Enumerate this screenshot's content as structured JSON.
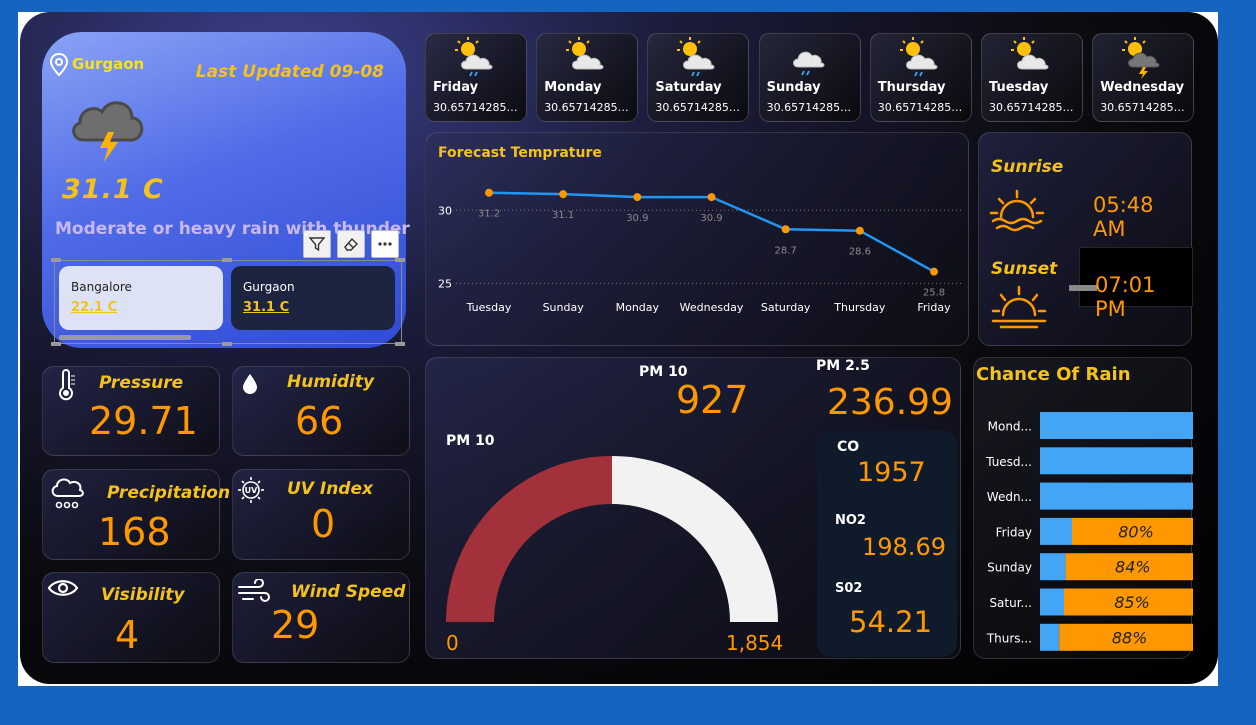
{
  "current": {
    "city": "Gurgaon",
    "last_updated": "Last Updated 09-08",
    "temperature": "31.1 C",
    "condition": "Moderate or heavy rain with thunder",
    "icon": "thunderstorm-cloud-icon"
  },
  "city_slicer": [
    {
      "name": "Bangalore",
      "temp": "22.1 C",
      "selected": false
    },
    {
      "name": "Gurgaon",
      "temp": "31.1 C",
      "selected": true
    }
  ],
  "forecast_tiles": [
    {
      "day": "Friday",
      "value": "30.657142857142857",
      "icon": "sun-cloud-rain-icon"
    },
    {
      "day": "Monday",
      "value": "30.657142857142857",
      "icon": "sun-cloud-icon"
    },
    {
      "day": "Saturday",
      "value": "30.657142857142857",
      "icon": "sun-cloud-rain-icon"
    },
    {
      "day": "Sunday",
      "value": "30.657142857142857",
      "icon": "cloud-rain-icon"
    },
    {
      "day": "Thursday",
      "value": "30.657142857142857",
      "icon": "sun-cloud-rain-icon"
    },
    {
      "day": "Tuesday",
      "value": "30.657142857142857",
      "icon": "sun-cloud-icon"
    },
    {
      "day": "Wednesday",
      "value": "30.657142857142857",
      "icon": "sun-thunder-icon"
    }
  ],
  "forecast_chart": {
    "title": "Forecast Temprature"
  },
  "chart_data": [
    {
      "type": "line",
      "title": "Forecast Temprature",
      "categories": [
        "Tuesday",
        "Sunday",
        "Monday",
        "Wednesday",
        "Saturday",
        "Thursday",
        "Friday"
      ],
      "values": [
        31.2,
        31.1,
        30.9,
        30.9,
        28.7,
        28.6,
        25.8
      ],
      "yticks": [
        25,
        30
      ],
      "ylim": [
        24,
        32
      ],
      "grid": true,
      "color": "#2196f3",
      "marker_color": "#ff9800"
    },
    {
      "type": "bar",
      "title": "Chance Of Rain",
      "categories": [
        "Mond...",
        "Tuesd...",
        "Wedn...",
        "Friday",
        "Sunday",
        "Satur...",
        "Thurs..."
      ],
      "series": [
        {
          "values": [
            100,
            100,
            100,
            20,
            16,
            15,
            12
          ],
          "color": "#42a5f5"
        },
        {
          "values": [
            0,
            0,
            0,
            80,
            84,
            85,
            88
          ],
          "labels": [
            "",
            "",
            "",
            "80%",
            "84%",
            "85%",
            "88%"
          ],
          "color": "#ff9800"
        }
      ],
      "stacked": true,
      "orientation": "horizontal"
    },
    {
      "type": "gauge",
      "title": "PM 10",
      "value": 927,
      "min": 0,
      "max": 1854,
      "min_label": "0",
      "max_label": "1,854",
      "fill_color": "#a3313b",
      "track_color": "#f2f2f2"
    }
  ],
  "sun": {
    "sunrise_label": "Sunrise",
    "sunrise_time": "05:48 AM",
    "sunset_label": "Sunset",
    "sunset_time": "07:01 PM"
  },
  "metrics": [
    {
      "label": "Pressure",
      "value": "29.71",
      "icon": "thermometer-icon"
    },
    {
      "label": "Humidity",
      "value": "66",
      "icon": "water-drop-icon"
    },
    {
      "label": "Precipitation",
      "value": "168",
      "icon": "rain-cloud-icon"
    },
    {
      "label": "UV Index",
      "value": "0",
      "icon": "uv-sun-icon"
    },
    {
      "label": "Visibility",
      "value": "4",
      "icon": "eye-icon"
    },
    {
      "label": "Wind Speed",
      "value": "29",
      "icon": "wind-icon"
    }
  ],
  "air": {
    "pm10_label": "PM 10",
    "pm10_value": "927",
    "pm25_label": "PM 2.5",
    "pm25_value": "236.99",
    "gauge_title": "PM 10",
    "co_label": "CO",
    "co_value": "1957",
    "no2_label": "NO2",
    "no2_value": "198.69",
    "so2_label": "S02",
    "so2_value": "54.21"
  },
  "rain": {
    "title": "Chance Of Rain"
  },
  "colors": {
    "accent_orange": "#ff9800",
    "accent_yellow": "#f4c21d",
    "line_blue": "#2196f3",
    "bar_blue": "#42a5f5",
    "gauge_red": "#a3313b"
  }
}
